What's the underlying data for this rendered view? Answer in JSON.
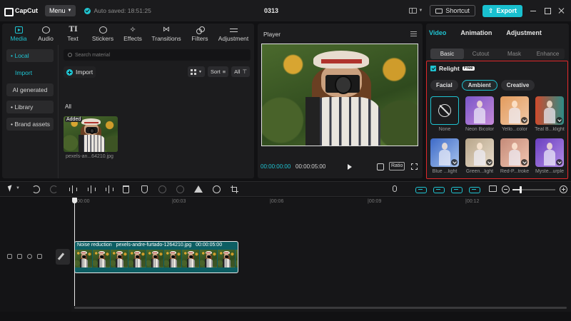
{
  "titlebar": {
    "app_name": "CapCut",
    "menu_label": "Menu",
    "autosave_text": "Auto saved: 18:51:25",
    "project_title": "0313",
    "shortcut_label": "Shortcut",
    "export_label": "Export"
  },
  "tool_tabs": [
    {
      "label": "Media",
      "icon": "media-icon",
      "active": true
    },
    {
      "label": "Audio",
      "icon": "audio-icon"
    },
    {
      "label": "Text",
      "icon": "text-icon"
    },
    {
      "label": "Stickers",
      "icon": "stickers-icon"
    },
    {
      "label": "Effects",
      "icon": "effects-icon"
    },
    {
      "label": "Transitions",
      "icon": "transitions-icon"
    },
    {
      "label": "Filters",
      "icon": "filters-icon"
    },
    {
      "label": "Adjustment",
      "icon": "adjustment-icon"
    }
  ],
  "media": {
    "side_nav": [
      "• Local",
      "Import",
      "AI generated",
      "• Library",
      "• Brand assets"
    ],
    "search_placeholder": "Search material",
    "import_label": "Import",
    "sort_label": "Sort",
    "filter_label": "All",
    "section_label": "All",
    "item": {
      "badge": "Added",
      "name": "pexels-an...64210.jpg"
    }
  },
  "player": {
    "title": "Player",
    "time_current": "00:00:00:00",
    "time_total": "00:00:05:00",
    "ratio_label": "Ratio"
  },
  "right_panel": {
    "tabs": [
      "Video",
      "Animation",
      "Adjustment"
    ],
    "active_tab": "Video",
    "sub_tabs": [
      "Basic",
      "Cutout",
      "Mask",
      "Enhance"
    ],
    "active_sub_tab": "Basic",
    "relight": {
      "title": "Relight",
      "badge": "Free",
      "modes": [
        "Facial",
        "Ambient",
        "Creative"
      ],
      "active_mode": "Ambient",
      "presets": [
        {
          "label": "None",
          "colors": [
            "#1b1b1d",
            "#1b1b1d"
          ]
        },
        {
          "label": "Neon Bicolor",
          "colors": [
            "#7b56c9",
            "#c58ad8"
          ]
        },
        {
          "label": "Yello...color",
          "colors": [
            "#e39b5c",
            "#f0c9a8"
          ]
        },
        {
          "label": "Teal B...klight",
          "colors": [
            "#d04a2c",
            "#2f8c86"
          ]
        },
        {
          "label": "Blue ...light",
          "colors": [
            "#3d6ac8",
            "#a7c4ee"
          ]
        },
        {
          "label": "Green...light",
          "colors": [
            "#b8a68a",
            "#e8dccb"
          ]
        },
        {
          "label": "Red-P...troke",
          "colors": [
            "#c48a78",
            "#f2c6b2"
          ]
        },
        {
          "label": "Myste...urple",
          "colors": [
            "#6a3fc0",
            "#b28be6"
          ]
        }
      ]
    }
  },
  "timeline": {
    "ruler_labels": [
      "00:00",
      "|00:03",
      "|00:06",
      "|00:09",
      "|00:12"
    ],
    "clip": {
      "effect": "Noise reduction",
      "file": "pexels-andre-furtado-1264210.jpg",
      "duration": "00:00:05:00"
    },
    "zoom_level": 0.18
  }
}
